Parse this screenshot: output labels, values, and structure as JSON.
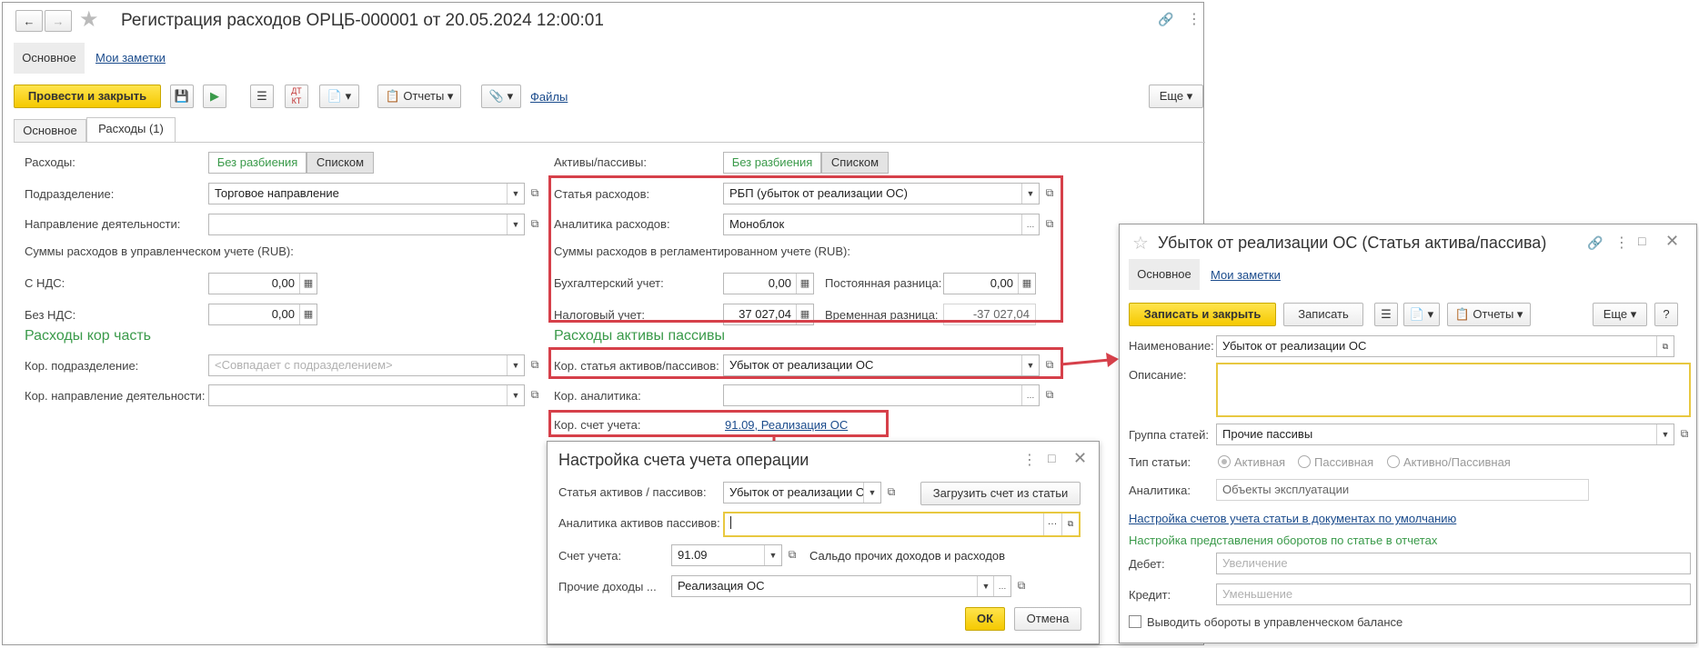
{
  "main": {
    "title": "Регистрация расходов ОРЦБ-000001 от 20.05.2024 12:00:01",
    "nav_tabs": [
      "Основное",
      "Мои заметки"
    ],
    "toolbar": {
      "post_close": "Провести и закрыть",
      "reports": "Отчеты",
      "files": "Файлы",
      "more": "Еще",
      "dtkt": "ДТ КТ"
    },
    "tabs": [
      "Основное",
      "Расходы (1)"
    ],
    "left": {
      "expenses_label": "Расходы:",
      "seg_no_split": "Без разбиения",
      "seg_list": "Списком",
      "division_label": "Подразделение:",
      "division_value": "Торговое направление",
      "activity_label": "Направление деятельности:",
      "activity_value": "",
      "mgmt_sums_label": "Суммы расходов в управленческом учете (RUB):",
      "with_vat_label": "С НДС:",
      "with_vat_value": "0,00",
      "without_vat_label": "Без НДС:",
      "without_vat_value": "0,00",
      "corr_section": "Расходы кор часть",
      "corr_division_label": "Кор. подразделение:",
      "corr_division_placeholder": "<Совпадает с подразделением>",
      "corr_activity_label": "Кор. направление деятельности:"
    },
    "right": {
      "assets_label": "Активы/пассивы:",
      "seg_no_split": "Без разбиения",
      "seg_list": "Списком",
      "expense_item_label": "Статья расходов:",
      "expense_item_value": "РБП (убыток от реализации ОС)",
      "analytics_label": "Аналитика расходов:",
      "analytics_value": "Моноблок",
      "reg_sums_label": "Суммы расходов в регламентированном учете (RUB):",
      "acc_label": "Бухгалтерский учет:",
      "acc_value": "0,00",
      "perm_diff_label": "Постоянная разница:",
      "perm_diff_value": "0,00",
      "tax_label": "Налоговый учет:",
      "tax_value": "37 027,04",
      "temp_diff_label": "Временная разница:",
      "temp_diff_value": "-37 027,04",
      "section": "Расходы активы пассивы",
      "corr_item_label": "Кор. статья активов/пассивов:",
      "corr_item_value": "Убыток от реализации ОС",
      "corr_analytics_label": "Кор. аналитика:",
      "corr_account_label": "Кор. счет учета:",
      "corr_account_value": "91.09, Реализация ОС"
    }
  },
  "dialog": {
    "title": "Настройка счета учета операции",
    "item_label": "Статья активов / пассивов:",
    "item_value": "Убыток от реализации ОС",
    "load_button": "Загрузить счет из статьи",
    "analytics_label": "Аналитика активов пассивов:",
    "account_label": "Счет учета:",
    "account_value": "91.09",
    "account_desc": "Сальдо прочих доходов и расходов",
    "other_income_label": "Прочие доходы ...",
    "other_income_value": "Реализация ОС",
    "ok": "ОК",
    "cancel": "Отмена"
  },
  "item_window": {
    "title": "Убыток от реализации ОС (Статья актива/пассива)",
    "nav_tabs": [
      "Основное",
      "Мои заметки"
    ],
    "save_close": "Записать и закрыть",
    "save": "Записать",
    "reports": "Отчеты",
    "more": "Еще",
    "help": "?",
    "name_label": "Наименование:",
    "name_value": "Убыток от реализации ОС",
    "desc_label": "Описание:",
    "group_label": "Группа статей:",
    "group_value": "Прочие пассивы",
    "type_label": "Тип статьи:",
    "type_options": [
      "Активная",
      "Пассивная",
      "Активно/Пассивная"
    ],
    "analytics_label": "Аналитика:",
    "analytics_value": "Объекты эксплуатации",
    "accounts_link": "Настройка счетов учета статьи в документах по умолчанию",
    "turnover_section": "Настройка представления оборотов по статье в отчетах",
    "debit_label": "Дебет:",
    "debit_placeholder": "Увеличение",
    "credit_label": "Кредит:",
    "credit_placeholder": "Уменьшение",
    "mgmt_checkbox": "Выводить обороты в управленческом балансе"
  },
  "colors": {
    "accent_yellow": "#f5c900",
    "highlight_red": "#d6404a",
    "section_green": "#3a9a4a",
    "link_blue": "#1a4b8c"
  }
}
